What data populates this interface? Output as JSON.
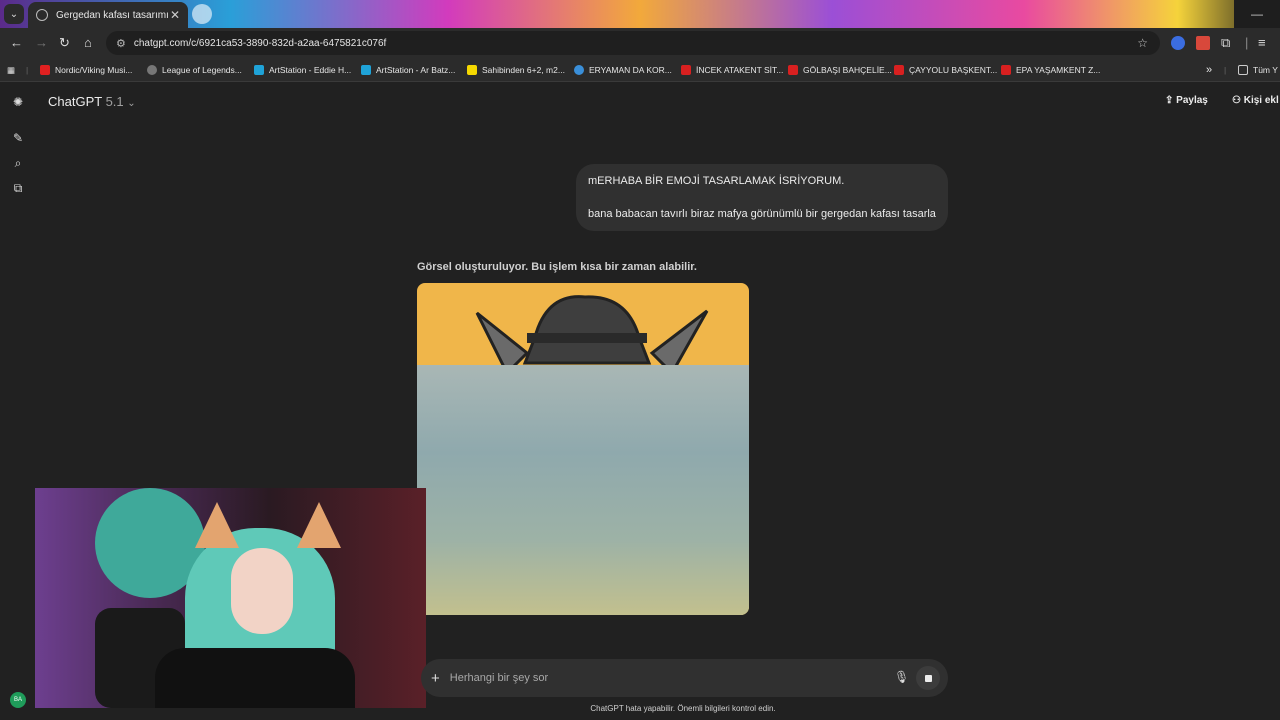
{
  "browser": {
    "tab_title": "Gergedan kafası tasarımı",
    "url": "chatgpt.com/c/6921ca53-3890-832d-a2aa-6475821c076f",
    "bookmarks": [
      "Nordic/Viking Musi...",
      "League of Legends...",
      "ArtStation - Eddie H...",
      "ArtStation - Ar Batz...",
      "Sahibinden 6+2, m2...",
      "ERYAMAN DA KOR...",
      "İNCEK ATAKENT SİT...",
      "GÖLBAŞI BAHÇELİE...",
      "ÇAYYOLU BAŞKENT...",
      "EPA YAŞAMKENT Z..."
    ],
    "all_bookmarks_label": "Tüm Y"
  },
  "header": {
    "model_name": "ChatGPT",
    "model_version": "5.1",
    "share_label": "Paylaş",
    "add_person_label": "Kişi ekl"
  },
  "conversation": {
    "user_message_line1": "mERHABA BİR EMOJİ TASARLAMAK İSRİYORUM.",
    "user_message_line2": "bana babacan tavırlı biraz mafya görünümlü bir gergedan kafası tasarla",
    "status_text": "Görsel oluşturuluyor. Bu işlem kısa bir zaman alabilir."
  },
  "composer": {
    "placeholder": "Herhangi bir şey sor"
  },
  "footer": {
    "disclaimer": "ChatGPT hata yapabilir. Önemli bilgileri kontrol edin.",
    "avatar_initials": "BA"
  },
  "colors": {
    "background": "#212121",
    "bubble": "#303030",
    "image_bg": "#f0b64a"
  }
}
